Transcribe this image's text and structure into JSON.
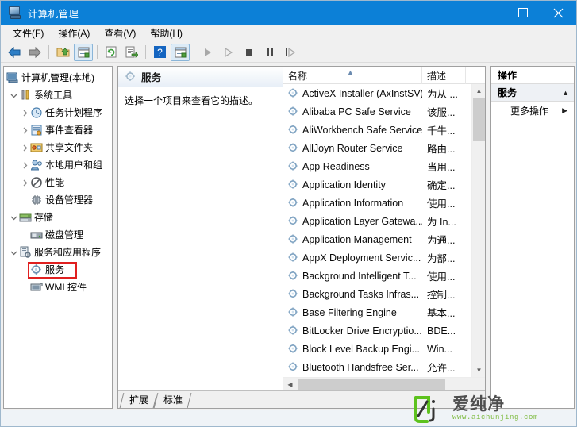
{
  "window": {
    "title": "计算机管理",
    "icon": "computer-management-icon",
    "buttons": {
      "minimize": "–",
      "maximize": "□",
      "close": "✕"
    }
  },
  "menubar": {
    "items": [
      {
        "label": "文件(F)"
      },
      {
        "label": "操作(A)"
      },
      {
        "label": "查看(V)"
      },
      {
        "label": "帮助(H)"
      }
    ]
  },
  "toolbar": {
    "buttons": [
      {
        "name": "back-icon"
      },
      {
        "name": "forward-icon"
      },
      {
        "name": "up-folder-icon"
      },
      {
        "name": "properties-icon"
      },
      {
        "name": "refresh-icon"
      },
      {
        "name": "export-list-icon"
      },
      {
        "name": "help-icon"
      },
      {
        "name": "show-console-tree-icon"
      },
      {
        "name": "start-service-icon"
      },
      {
        "name": "resume-service-icon"
      },
      {
        "name": "stop-service-icon"
      },
      {
        "name": "pause-service-icon"
      },
      {
        "name": "restart-service-icon"
      }
    ]
  },
  "tree": {
    "nodes": [
      {
        "label": "计算机管理(本地)",
        "indent": 0,
        "twisty": "none",
        "icon": "computer-icon"
      },
      {
        "label": "系统工具",
        "indent": 1,
        "twisty": "expanded",
        "icon": "system-tools-icon"
      },
      {
        "label": "任务计划程序",
        "indent": 2,
        "twisty": "collapsed",
        "icon": "task-scheduler-icon"
      },
      {
        "label": "事件查看器",
        "indent": 2,
        "twisty": "collapsed",
        "icon": "event-viewer-icon"
      },
      {
        "label": "共享文件夹",
        "indent": 2,
        "twisty": "collapsed",
        "icon": "shared-folders-icon"
      },
      {
        "label": "本地用户和组",
        "indent": 2,
        "twisty": "collapsed",
        "icon": "local-users-groups-icon"
      },
      {
        "label": "性能",
        "indent": 2,
        "twisty": "collapsed",
        "icon": "performance-icon"
      },
      {
        "label": "设备管理器",
        "indent": 2,
        "twisty": "none",
        "icon": "device-manager-icon"
      },
      {
        "label": "存储",
        "indent": 1,
        "twisty": "expanded",
        "icon": "storage-icon"
      },
      {
        "label": "磁盘管理",
        "indent": 2,
        "twisty": "none",
        "icon": "disk-management-icon"
      },
      {
        "label": "服务和应用程序",
        "indent": 1,
        "twisty": "expanded",
        "icon": "services-apps-icon"
      },
      {
        "label": "服务",
        "indent": 2,
        "twisty": "none",
        "icon": "services-icon",
        "highlighted": true
      },
      {
        "label": "WMI 控件",
        "indent": 2,
        "twisty": "none",
        "icon": "wmi-control-icon"
      }
    ],
    "highlight_color": "#e02020"
  },
  "center": {
    "description_panel": {
      "header_title": "服务",
      "header_icon": "services-icon",
      "body_text": "选择一个项目来查看它的描述。"
    },
    "list": {
      "columns": [
        {
          "label": "名称",
          "sort": "ascending"
        },
        {
          "label": "描述"
        }
      ],
      "rows": [
        {
          "name": "ActiveX Installer (AxInstSV)",
          "desc": "为从 ..."
        },
        {
          "name": "Alibaba PC Safe Service",
          "desc": "该服..."
        },
        {
          "name": "AliWorkbench Safe Service",
          "desc": "千牛..."
        },
        {
          "name": "AllJoyn Router Service",
          "desc": "路由..."
        },
        {
          "name": "App Readiness",
          "desc": "当用..."
        },
        {
          "name": "Application Identity",
          "desc": "确定..."
        },
        {
          "name": "Application Information",
          "desc": "使用..."
        },
        {
          "name": "Application Layer Gatewa...",
          "desc": "为 In..."
        },
        {
          "name": "Application Management",
          "desc": "为通..."
        },
        {
          "name": "AppX Deployment Servic...",
          "desc": "为部..."
        },
        {
          "name": "Background Intelligent T...",
          "desc": "使用..."
        },
        {
          "name": "Background Tasks Infras...",
          "desc": "控制..."
        },
        {
          "name": "Base Filtering Engine",
          "desc": "基本..."
        },
        {
          "name": "BitLocker Drive Encryptio...",
          "desc": "BDE..."
        },
        {
          "name": "Block Level Backup Engi...",
          "desc": "Win..."
        },
        {
          "name": "Bluetooth Handsfree Ser...",
          "desc": "允许..."
        }
      ]
    },
    "tabs": [
      {
        "label": "扩展",
        "selected": false
      },
      {
        "label": "标准",
        "selected": true
      }
    ]
  },
  "actions": {
    "title": "操作",
    "group_label": "服务",
    "group_chevron": "▲",
    "items": [
      {
        "label": "更多操作",
        "arrow": "▶"
      }
    ]
  },
  "watermark": {
    "brand": "爱纯净",
    "url": "www.aichunjing.com",
    "mark_color": "#5dc21e",
    "text_color": "#4e4e4e"
  },
  "colors": {
    "titlebar": "#0c80d7",
    "window_bg": "#f0f0f0",
    "pane_bg": "#ffffff"
  }
}
